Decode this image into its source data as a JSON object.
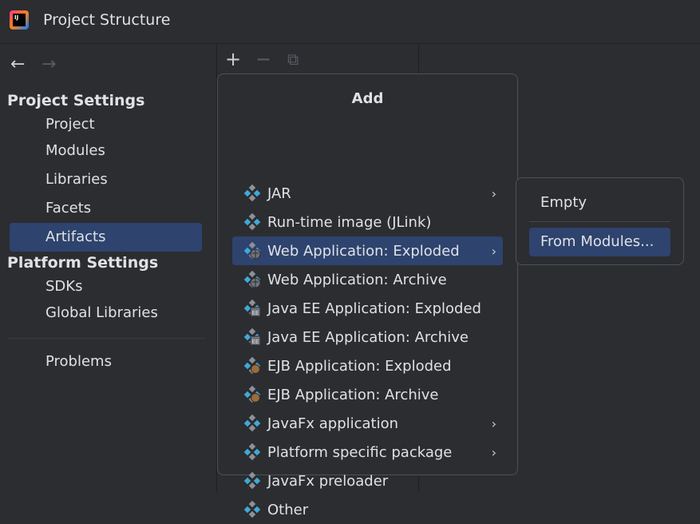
{
  "window": {
    "title": "Project Structure"
  },
  "nav": {
    "back": "←",
    "forward": "→"
  },
  "sidebar": {
    "project_settings": "Project Settings",
    "project_items": [
      "Project",
      "Modules",
      "Libraries",
      "Facets",
      "Artifacts"
    ],
    "platform_settings": "Platform Settings",
    "platform_items": [
      "SDKs",
      "Global Libraries"
    ],
    "problems": "Problems",
    "selected": "Artifacts"
  },
  "toolbar": {
    "add": "+",
    "remove": "−",
    "copy": "⧉"
  },
  "popup": {
    "title": "Add",
    "items": [
      {
        "label": "JAR",
        "icon": "artifact-icon",
        "submenu": true
      },
      {
        "label": "Run-time image (JLink)",
        "icon": "artifact-icon",
        "submenu": false
      },
      {
        "label": "Web Application: Exploded",
        "icon": "web-artifact-icon",
        "submenu": true
      },
      {
        "label": "Web Application: Archive",
        "icon": "web-artifact-icon",
        "submenu": false
      },
      {
        "label": "Java EE Application: Exploded",
        "icon": "javaee-artifact-icon",
        "submenu": false
      },
      {
        "label": "Java EE Application: Archive",
        "icon": "javaee-artifact-icon",
        "submenu": false
      },
      {
        "label": "EJB Application: Exploded",
        "icon": "ejb-artifact-icon",
        "submenu": false
      },
      {
        "label": "EJB Application: Archive",
        "icon": "ejb-artifact-icon",
        "submenu": false
      },
      {
        "label": "JavaFx application",
        "icon": "artifact-icon",
        "submenu": true
      },
      {
        "label": "Platform specific package",
        "icon": "artifact-icon",
        "submenu": true
      },
      {
        "label": "JavaFx preloader",
        "icon": "artifact-icon",
        "submenu": false
      },
      {
        "label": "Other",
        "icon": "artifact-icon",
        "submenu": false
      }
    ],
    "selected_index": 2,
    "chevron": "›"
  },
  "submenu": {
    "items": [
      "Empty",
      "From Modules..."
    ],
    "selected": "From Modules..."
  },
  "colors": {
    "accent": "#2e436e",
    "blue": "#3fa9d8",
    "grey": "#8c9199"
  }
}
